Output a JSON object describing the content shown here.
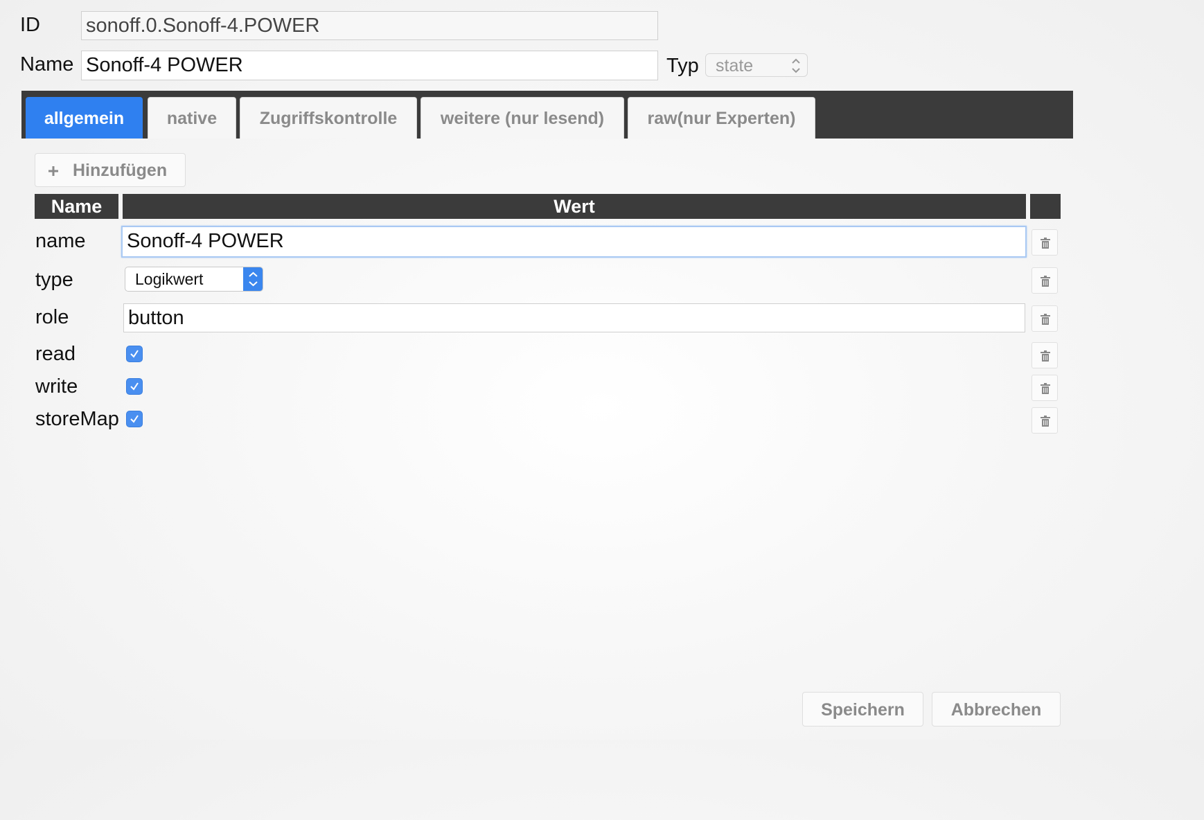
{
  "header": {
    "id_label": "ID",
    "id_value": "sonoff.0.Sonoff-4.POWER",
    "name_label": "Name",
    "name_value": "Sonoff-4 POWER",
    "typ_label": "Typ",
    "typ_value": "state"
  },
  "tabs": [
    {
      "label": "allgemein",
      "active": true
    },
    {
      "label": "native"
    },
    {
      "label": "Zugriffskontrolle"
    },
    {
      "label": "weitere (nur lesend)"
    },
    {
      "label": "raw(nur Experten)"
    }
  ],
  "toolbar": {
    "add_icon": "plus-icon",
    "add_label": "Hinzufügen"
  },
  "table": {
    "columns": [
      "Name",
      "Wert",
      ""
    ],
    "rows": [
      {
        "name": "name",
        "kind": "text",
        "value": "Sonoff-4 POWER"
      },
      {
        "name": "type",
        "kind": "select",
        "value": "Logikwert"
      },
      {
        "name": "role",
        "kind": "text",
        "value": "button"
      },
      {
        "name": "read",
        "kind": "checkbox",
        "checked": true
      },
      {
        "name": "write",
        "kind": "checkbox",
        "checked": true
      },
      {
        "name": "storeMap",
        "kind": "checkbox",
        "checked": true
      }
    ],
    "delete_icon": "trash-icon"
  },
  "footer": {
    "save_label": "Speichern",
    "cancel_label": "Abbrechen"
  },
  "colors": {
    "accent": "#2f80f0",
    "header_dark": "#3b3b3b",
    "checkbox": "#4a8ff0"
  }
}
